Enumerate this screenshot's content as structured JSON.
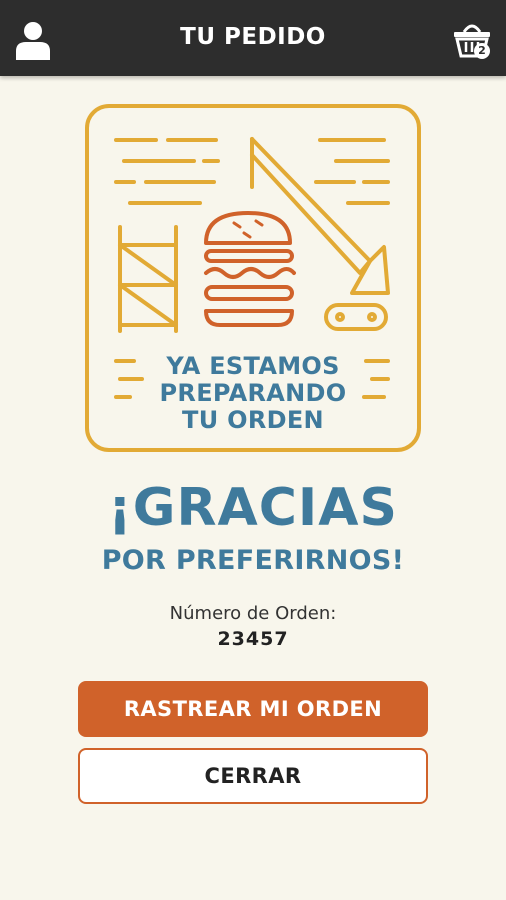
{
  "header": {
    "title": "TU PEDIDO",
    "user_icon": "user-icon",
    "cart_icon": "basket-icon",
    "cart_count": "2"
  },
  "illustration": {
    "line1": "YA ESTAMOS",
    "line2": "PREPARANDO",
    "line3": "TU ORDEN",
    "icon": "burger-construction-icon"
  },
  "thanks": {
    "title": "¡GRACIAS",
    "subtitle": "POR PREFERIRNOS!"
  },
  "order": {
    "label": "Número de Orden:",
    "number": "23457"
  },
  "buttons": {
    "track": "RASTREAR MI ORDEN",
    "close": "CERRAR"
  },
  "colors": {
    "topbar": "#2d2d2d",
    "background": "#f8f6ec",
    "accent_orange": "#d0622a",
    "accent_blue": "#3f7a9c",
    "illustration_gold": "#e2aa35"
  }
}
